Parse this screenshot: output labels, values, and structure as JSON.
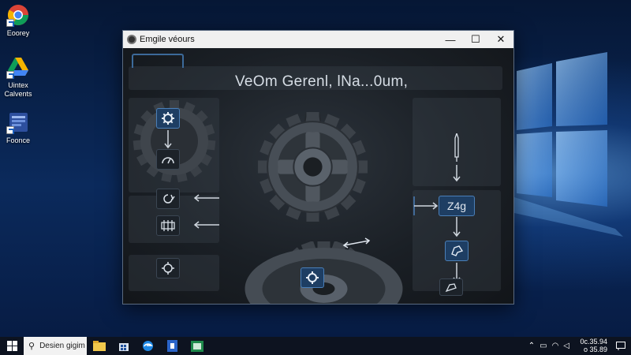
{
  "desktop": {
    "icons": [
      {
        "label": "Eoorey",
        "icon": "chrome-icon"
      },
      {
        "label": "Uintex Calvents",
        "icon": "drive-icon"
      },
      {
        "label": "Foonce",
        "icon": "app-icon"
      }
    ]
  },
  "window": {
    "title": "Emgile véours",
    "heading": "VeOm Gerenl, lNa...0um,",
    "controls": {
      "minimize": "—",
      "maximize": "☐",
      "close": "✕"
    },
    "flow_right": {
      "value_label": "Z4g"
    }
  },
  "taskbar": {
    "search_text": "Desien gigim",
    "time": "0c.35.94",
    "date": "o 35.89",
    "apps": [
      "file-explorer-icon",
      "store-icon",
      "edge-icon",
      "security-icon",
      "app-icon"
    ]
  },
  "colors": {
    "accent": "#4a7fb8",
    "window_bg": "#171b20",
    "titlebar": "#f0f0f0",
    "wallpaper": "#0b2a5c"
  }
}
